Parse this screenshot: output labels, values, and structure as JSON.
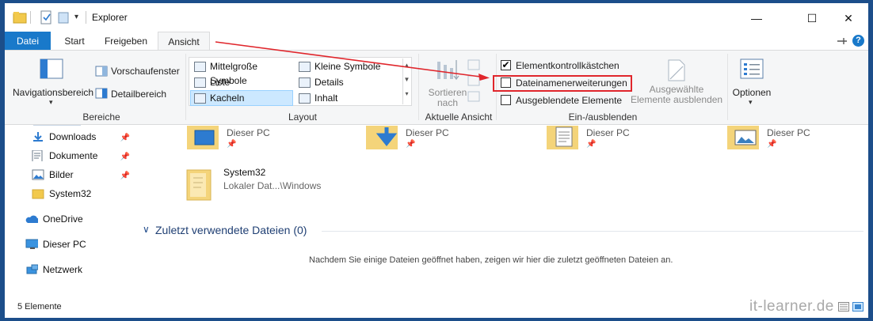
{
  "titlebar": {
    "title": "Explorer",
    "minimize_glyph": "—",
    "maximize_glyph": "☐",
    "close_glyph": "✕"
  },
  "tabs": [
    {
      "label": "Datei"
    },
    {
      "label": "Start"
    },
    {
      "label": "Freigeben"
    },
    {
      "label": "Ansicht"
    }
  ],
  "ribbon": {
    "bereiche": {
      "title": "Bereiche",
      "navigationsbereich": "Navigationsbereich",
      "vorschaufenster": "Vorschaufenster",
      "detailbereich": "Detailbereich"
    },
    "layout": {
      "title": "Layout",
      "items": [
        {
          "label": "Mittelgroße Symbole"
        },
        {
          "label": "Kleine Symbole"
        },
        {
          "label": "Liste"
        },
        {
          "label": "Details"
        },
        {
          "label": "Kacheln"
        },
        {
          "label": "Inhalt"
        }
      ]
    },
    "aktuelle_ansicht": {
      "title": "Aktuelle Ansicht",
      "sortieren_line1": "Sortieren",
      "sortieren_line2": "nach"
    },
    "ein_ausblenden": {
      "title": "Ein-/ausblenden",
      "elementkontrollkaestchen": "Elementkontrollkästchen",
      "dateinamenerweiterungen": "Dateinamenerweiterungen",
      "ausgeblendete_elemente": "Ausgeblendete Elemente",
      "ausgewaehlte_line1": "Ausgewählte",
      "ausgewaehlte_line2": "Elemente ausblenden",
      "elementkontrollkaestchen_checked": true,
      "dateinamenerweiterungen_checked": false,
      "ausgeblendete_elemente_checked": false
    },
    "optionen": {
      "label": "Optionen"
    }
  },
  "nav": {
    "items": [
      {
        "label": "Downloads"
      },
      {
        "label": "Dokumente"
      },
      {
        "label": "Bilder"
      },
      {
        "label": "System32"
      },
      {
        "label": "OneDrive"
      },
      {
        "label": "Dieser PC"
      },
      {
        "label": "Netzwerk"
      }
    ]
  },
  "content": {
    "tiles": [
      {
        "label": "Dieser PC"
      },
      {
        "label": "Dieser PC"
      },
      {
        "label": "Dieser PC"
      },
      {
        "label": "Dieser PC"
      }
    ],
    "system32": {
      "title": "System32",
      "subtitle": "Lokaler Dat...\\Windows"
    },
    "recent": {
      "heading": "Zuletzt verwendete Dateien (0)",
      "empty_text": "Nachdem Sie einige Dateien geöffnet haben, zeigen wir hier die zuletzt geöffneten Dateien an."
    }
  },
  "status": {
    "count": "5 Elemente"
  },
  "watermark": "it-learner.de",
  "colors": {
    "file_tab": "#1979ca",
    "highlight_box": "#e0262c",
    "arrow": "#e0262c",
    "selection": "#cce8ff"
  }
}
